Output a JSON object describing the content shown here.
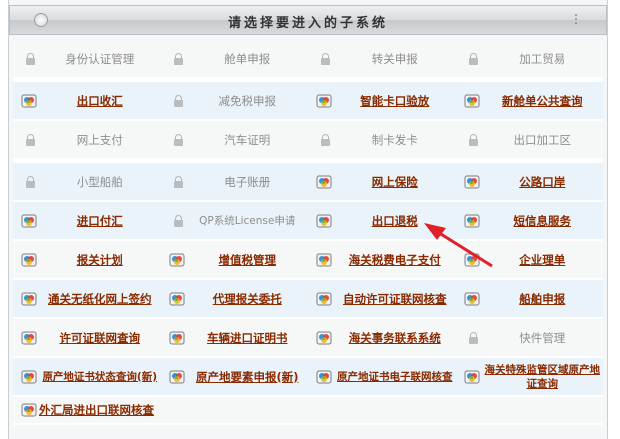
{
  "header": {
    "title": "请选择要进入的子系统"
  },
  "rows": [
    [
      {
        "label": "身份认证管理",
        "state": "locked"
      },
      {
        "label": "舱单申报",
        "state": "locked"
      },
      {
        "label": "转关申报",
        "state": "locked"
      },
      {
        "label": "加工贸易",
        "state": "locked"
      }
    ],
    [
      {
        "label": "出口收汇",
        "state": "active"
      },
      {
        "label": "减免税申报",
        "state": "locked"
      },
      {
        "label": "智能卡口验放",
        "state": "active"
      },
      {
        "label": "新舱单公共查询",
        "state": "active"
      }
    ],
    [
      {
        "label": "网上支付",
        "state": "locked"
      },
      {
        "label": "汽车证明",
        "state": "locked"
      },
      {
        "label": "制卡发卡",
        "state": "locked"
      },
      {
        "label": "出口加工区",
        "state": "locked"
      }
    ],
    [
      {
        "label": "小型船舶",
        "state": "locked"
      },
      {
        "label": "电子账册",
        "state": "locked"
      },
      {
        "label": "网上保险",
        "state": "active"
      },
      {
        "label": "公路口岸",
        "state": "active"
      }
    ],
    [
      {
        "label": "进口付汇",
        "state": "active"
      },
      {
        "label": "QP系统License申请",
        "state": "locked"
      },
      {
        "label": "出口退税",
        "state": "active"
      },
      {
        "label": "短信息服务",
        "state": "active"
      }
    ],
    [
      {
        "label": "报关计划",
        "state": "active"
      },
      {
        "label": "增值税管理",
        "state": "active"
      },
      {
        "label": "海关税费电子支付",
        "state": "active"
      },
      {
        "label": "企业理单",
        "state": "active"
      }
    ],
    [
      {
        "label": "通关无纸化网上签约",
        "state": "active"
      },
      {
        "label": "代理报关委托",
        "state": "active"
      },
      {
        "label": "自动许可证联网核查",
        "state": "active"
      },
      {
        "label": "船舶申报",
        "state": "active"
      }
    ],
    [
      {
        "label": "许可证联网查询",
        "state": "active"
      },
      {
        "label": "车辆进口证明书",
        "state": "active"
      },
      {
        "label": "海关事务联系系统",
        "state": "active"
      },
      {
        "label": "快件管理",
        "state": "locked"
      }
    ],
    [
      {
        "label": "原产地证书状态查询(新)",
        "state": "active"
      },
      {
        "label": "原产地要素申报(新)",
        "state": "active"
      },
      {
        "label": "原产地证书电子联网核查",
        "state": "active"
      },
      {
        "label": "海关特殊监管区域原产地证查询",
        "state": "active"
      }
    ],
    [
      {
        "label": "外汇局进出口联网核查",
        "state": "active"
      }
    ]
  ],
  "colors": {
    "active_text": "#8a2a00",
    "locked_text": "#8e8e8e",
    "arrow": "#e0202a"
  },
  "icons": {
    "active": "system-app-icon",
    "locked": "lock-icon",
    "arrow": "red-arrow-annotation"
  }
}
